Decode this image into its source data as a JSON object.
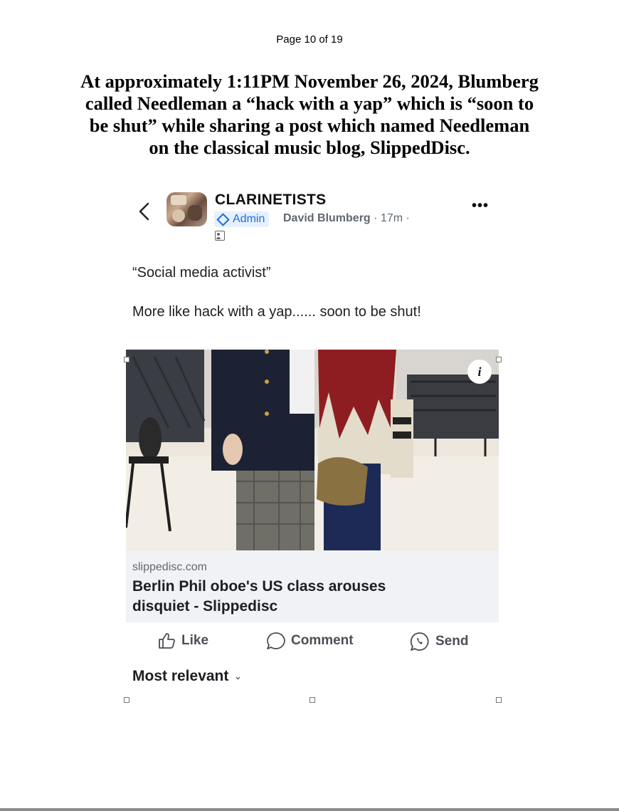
{
  "page": {
    "number_text": "Page 10 of 19",
    "heading_lines": [
      "At approximately 1:11PM November 26, 2024, Blumberg",
      "called Needleman a “hack with a yap” which is “soon to",
      "be shut” while sharing a post which named Needleman",
      "on the classical music blog, SlippedDisc."
    ]
  },
  "post": {
    "group_name": "CLARINETISTS",
    "badge": "Admin",
    "author": "David Blumberg",
    "time": "· 17m ·",
    "back_icon": "chevron-left-icon",
    "more_icon": "more-horizontal-icon",
    "privacy_icon": "group-members-icon",
    "text_line_1": "“Social media activist”",
    "text_line_2": "More like hack with a yap...... soon to be shut!",
    "link": {
      "domain": "slippedisc.com",
      "title_line_1": "Berlin Phil oboe's US class arouses",
      "title_line_2": "disquiet - Slippedisc",
      "info_label": "i"
    },
    "actions": {
      "like": "Like",
      "comment": "Comment",
      "send": "Send"
    },
    "sort_label": "Most relevant"
  },
  "colors": {
    "accent": "#1a6fe0",
    "badge_bg": "#e7f0fd",
    "link_card_bg": "#f0f2f5",
    "muted_text": "#65676b"
  }
}
